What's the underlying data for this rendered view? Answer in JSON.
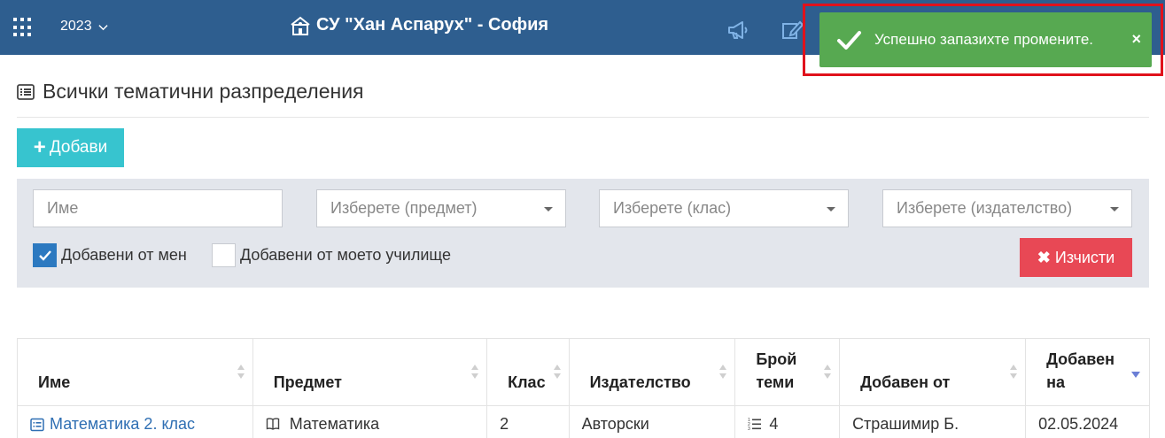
{
  "header": {
    "apps_icon": "grid-icon",
    "year": "2023",
    "school_name": "СУ \"Хан Аспарух\" - София",
    "school_icon": "school-icon",
    "icons": [
      "megaphone-icon",
      "edit-icon"
    ],
    "bar_color": "#2e5e8f"
  },
  "toast": {
    "icon": "check-icon",
    "message": "Успешно запазихте промените.",
    "close_label": "×",
    "color": "#57a951",
    "highlight_color": "#e0121c"
  },
  "page": {
    "title": "Всички тематични разпределения",
    "title_icon": "list-icon",
    "add_button": "Добави",
    "add_color": "#37c4cf"
  },
  "filters": {
    "name_placeholder": "Име",
    "subject_placeholder": "Изберете (предмет)",
    "class_placeholder": "Изберете (клас)",
    "publisher_placeholder": "Изберете (издателство)",
    "added_by_me": {
      "label": "Добавени от мен",
      "checked": true
    },
    "added_by_school": {
      "label": "Добавени от моето училище",
      "checked": false
    },
    "clear_button": "Изчисти",
    "clear_color": "#e84855"
  },
  "table": {
    "columns": [
      {
        "line1": "Име",
        "line2": ""
      },
      {
        "line1": "Предмет",
        "line2": ""
      },
      {
        "line1": "Клас",
        "line2": ""
      },
      {
        "line1": "Издателство",
        "line2": ""
      },
      {
        "line1": "Брой",
        "line2": "теми"
      },
      {
        "line1": "Добавен от",
        "line2": ""
      },
      {
        "line1": "Добавен",
        "line2": "на"
      }
    ],
    "sorted_column": "Добавен на",
    "sort_direction": "desc",
    "rows": [
      {
        "name": "Математика 2. клас",
        "subject": "Математика",
        "class": "2",
        "publisher": "Авторски",
        "topics": "4",
        "added_by": "Страшимир Б.",
        "added_on": "02.05.2024"
      }
    ]
  }
}
